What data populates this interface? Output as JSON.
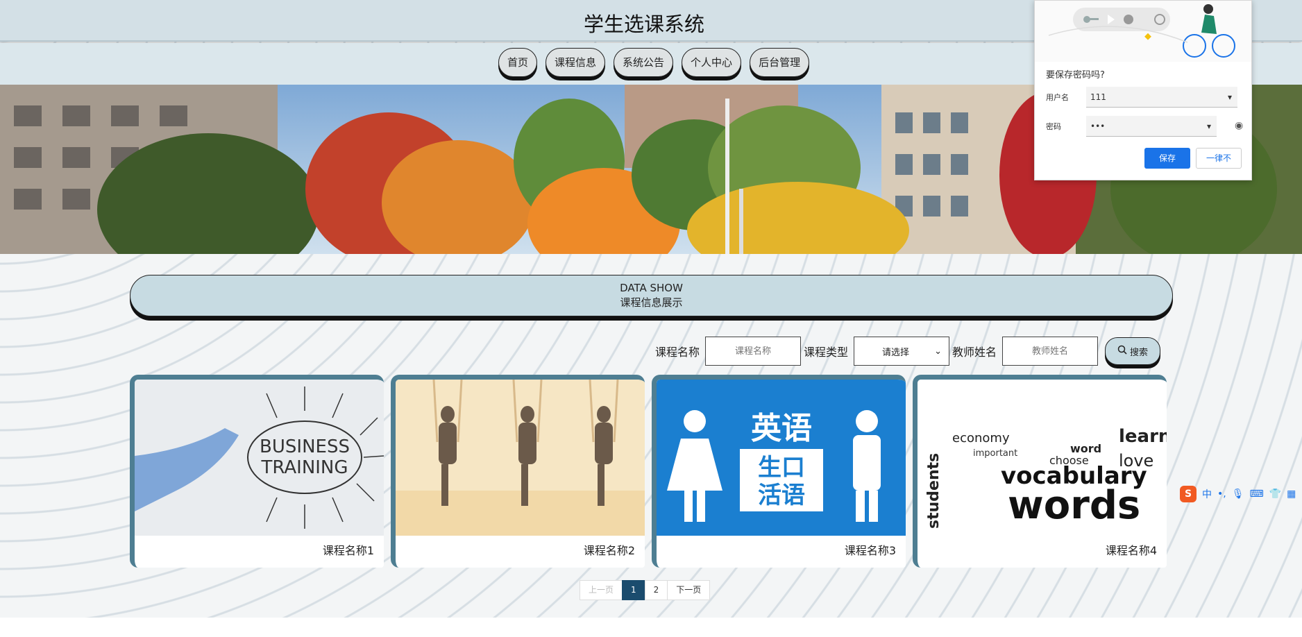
{
  "site": {
    "title": "学生选课系统"
  },
  "nav": {
    "items": [
      "首页",
      "课程信息",
      "系统公告",
      "个人中心",
      "后台管理"
    ]
  },
  "section": {
    "title_en": "DATA SHOW",
    "title_cn": "课程信息展示"
  },
  "search": {
    "course_name_label": "课程名称",
    "course_name_placeholder": "课程名称",
    "course_type_label": "课程类型",
    "course_type_value": "请选择",
    "teacher_label": "教师姓名",
    "teacher_placeholder": "教师姓名",
    "button_label": "搜索"
  },
  "cards": [
    {
      "name": "课程名称1",
      "image_text": [
        "BUSINESS",
        "TRAINING"
      ]
    },
    {
      "name": "课程名称2"
    },
    {
      "name": "课程名称3",
      "image_text": [
        "英语",
        "生口",
        "活语"
      ]
    },
    {
      "name": "课程名称4",
      "image_text": [
        "vocabulary",
        "words",
        "economy",
        "learn",
        "love",
        "students",
        "choose",
        "important",
        "word"
      ]
    }
  ],
  "pagination": {
    "prev": "上一页",
    "pages": [
      "1",
      "2"
    ],
    "current": "1",
    "next": "下一页"
  },
  "password_popup": {
    "question": "要保存密码吗?",
    "username_label": "用户名",
    "username_value": "111",
    "password_label": "密码",
    "password_value": "•••",
    "save_label": "保存",
    "never_label": "一律不"
  },
  "ime": {
    "mode": "中"
  },
  "colors": {
    "header": "#d3e0e6",
    "accent": "#4e7e92",
    "active_page": "#1b4c6e",
    "save_button": "#1a73e8"
  }
}
